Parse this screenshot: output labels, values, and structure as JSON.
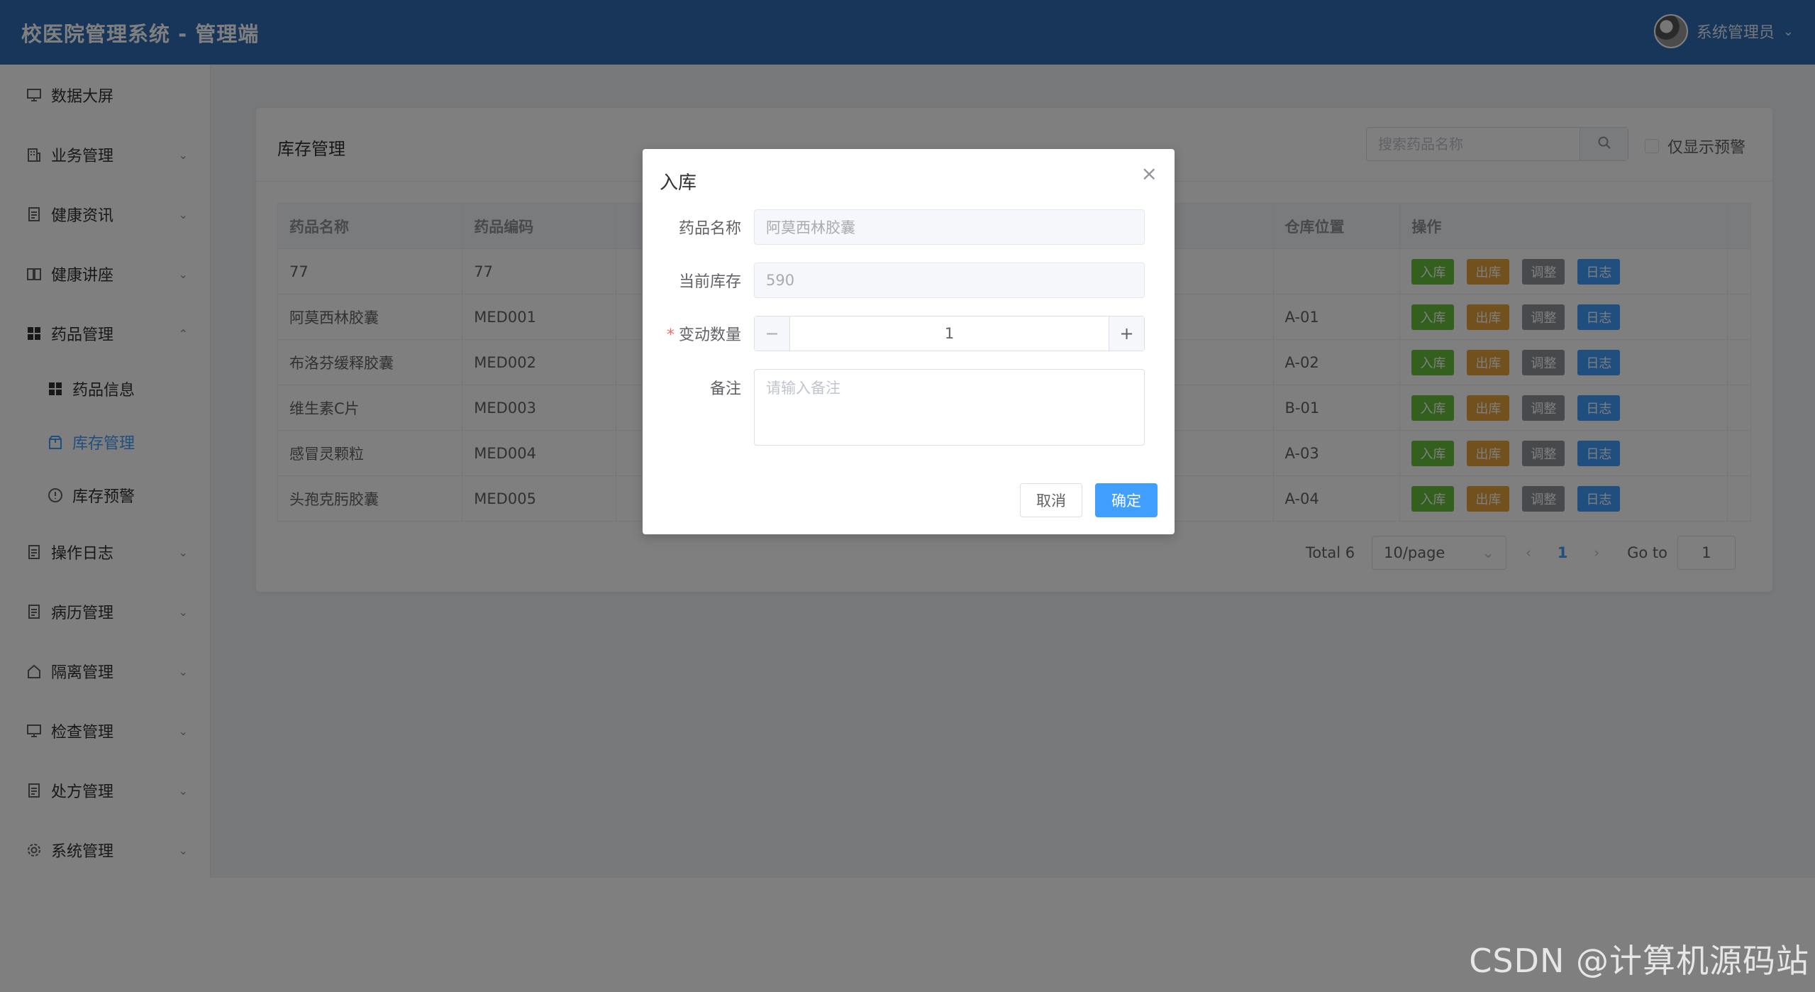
{
  "header": {
    "title": "校医院管理系统 - 管理端",
    "user_name": "系统管理员"
  },
  "sidebar": {
    "items": [
      {
        "label": "数据大屏",
        "icon": "monitor-icon"
      },
      {
        "label": "业务管理",
        "icon": "building-icon"
      },
      {
        "label": "健康资讯",
        "icon": "document-icon"
      },
      {
        "label": "健康讲座",
        "icon": "book-icon"
      },
      {
        "label": "药品管理",
        "icon": "grid-icon"
      },
      {
        "label": "药品信息",
        "icon": "grid-icon"
      },
      {
        "label": "库存管理",
        "icon": "box-icon"
      },
      {
        "label": "库存预警",
        "icon": "warning-icon"
      },
      {
        "label": "操作日志",
        "icon": "document-icon"
      },
      {
        "label": "病历管理",
        "icon": "document-icon"
      },
      {
        "label": "隔离管理",
        "icon": "house-icon"
      },
      {
        "label": "检查管理",
        "icon": "monitor-icon"
      },
      {
        "label": "处方管理",
        "icon": "document-icon"
      },
      {
        "label": "系统管理",
        "icon": "gear-icon"
      }
    ]
  },
  "card": {
    "title": "库存管理",
    "search_placeholder": "搜索药品名称",
    "warn_only_label": "仅显示预警"
  },
  "table": {
    "columns": [
      "药品名称",
      "药品编码",
      "",
      "",
      "",
      "",
      "仓库位置",
      "操作"
    ],
    "rows": [
      {
        "name": "77",
        "code": "77",
        "location": ""
      },
      {
        "name": "阿莫西林胶囊",
        "code": "MED001",
        "location": "A-01"
      },
      {
        "name": "布洛芬缓释胶囊",
        "code": "MED002",
        "location": "A-02"
      },
      {
        "name": "维生素C片",
        "code": "MED003",
        "location": "B-01"
      },
      {
        "name": "感冒灵颗粒",
        "code": "MED004",
        "location": "A-03"
      },
      {
        "name": "头孢克肟胶囊",
        "code": "MED005",
        "location": "A-04"
      }
    ],
    "actions": {
      "in": "入库",
      "out": "出库",
      "adjust": "调整",
      "log": "日志"
    }
  },
  "pagination": {
    "total": "Total 6",
    "page_size": "10/page",
    "current_page": "1",
    "goto_label": "Go to",
    "goto_value": "1"
  },
  "dialog": {
    "title": "入库",
    "fields": {
      "name_label": "药品名称",
      "name_value": "阿莫西林胶囊",
      "stock_label": "当前库存",
      "stock_value": "590",
      "qty_label": "变动数量",
      "qty_value": "1",
      "remark_label": "备注",
      "remark_placeholder": "请输入备注"
    },
    "cancel": "取消",
    "confirm": "确定"
  },
  "watermark": "CSDN @计算机源码站"
}
